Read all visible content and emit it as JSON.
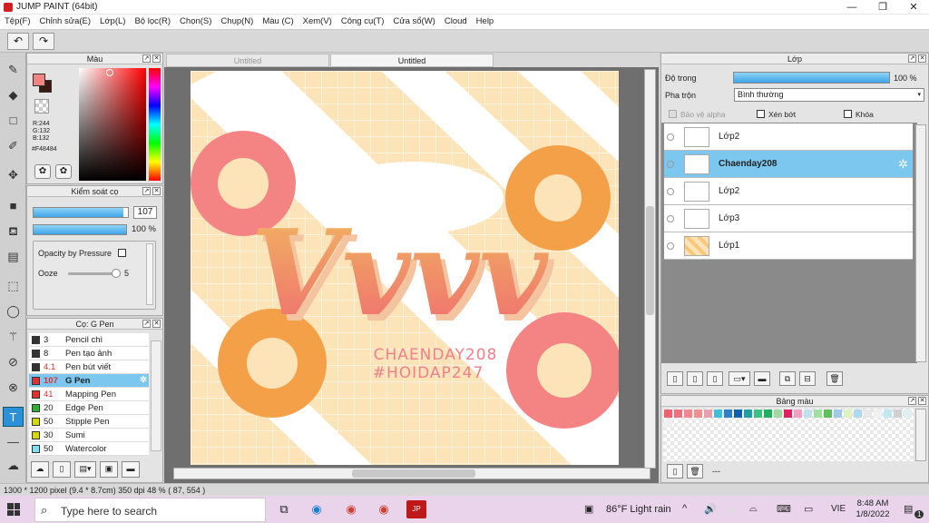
{
  "window": {
    "title": "JUMP PAINT (64bit)",
    "minimize": "—",
    "maximize": "❐",
    "close": "✕"
  },
  "menu": [
    "Tệp(F)",
    "Chỉnh sửa(E)",
    "Lớp(L)",
    "Bộ lọc(R)",
    "Chọn(S)",
    "Chụp(N)",
    "Màu (C)",
    "Xem(V)",
    "Công cụ(T)",
    "Cửa sổ(W)",
    "Cloud",
    "Help"
  ],
  "toolbar": {
    "undo": "↶",
    "redo": "↷"
  },
  "tabs": [
    "Untitled",
    "Untitled"
  ],
  "color_panel": {
    "title": "Màu",
    "r": "R:244",
    "g": "G:132",
    "b": "B:132",
    "hex": "#F48484",
    "main_color": "#f48484",
    "sub_color": "#3a1a10"
  },
  "brush_control": {
    "title": "Kiểm soát cọ",
    "size_value": "107",
    "size_fill": 0.95,
    "opacity_value": "100 %",
    "opacity_fill": 1.0,
    "opacity_by_pressure": "Opacity by Pressure",
    "ooze_label": "Ooze",
    "ooze_value": "5"
  },
  "brush_list": {
    "title": "Cọ: G Pen",
    "items": [
      {
        "size": "3",
        "name": "Pencil chì",
        "color": "#333333"
      },
      {
        "size": "8",
        "name": "Pen tạo ảnh",
        "color": "#333333"
      },
      {
        "size": "4.1",
        "name": "Pen bút viết",
        "color": "#333333"
      },
      {
        "size": "107",
        "name": "G Pen",
        "color": "#e03030"
      },
      {
        "size": "41",
        "name": "Mapping Pen",
        "color": "#e03030"
      },
      {
        "size": "20",
        "name": "Edge Pen",
        "color": "#30b030"
      },
      {
        "size": "50",
        "name": "Stipple Pen",
        "color": "#d8d800"
      },
      {
        "size": "30",
        "name": "Sumi",
        "color": "#d8d800"
      },
      {
        "size": "50",
        "name": "Watercolor",
        "color": "#80e0f0"
      }
    ]
  },
  "artwork": {
    "text_main": "Vvvv",
    "credit1": "CHAENDAY208",
    "credit2": "#HOIDAP247"
  },
  "layer_panel": {
    "title": "Lớp",
    "opacity_label": "Độ trong",
    "opacity_value": "100 %",
    "blend_label": "Pha trộn",
    "blend_value": "Bình thường",
    "protect_alpha": "Bảo vệ alpha",
    "clipping": "Xén bớt",
    "lock": "Khóa",
    "layers": [
      "Lớp2",
      "Chaenday208",
      "Lớp2",
      "Lớp3",
      "Lớp1"
    ]
  },
  "palette": {
    "title": "Bảng màu",
    "colors": [
      "#f06070",
      "#f07080",
      "#f08890",
      "#f09090",
      "#e8a0b0",
      "#40c0d8",
      "#3080c8",
      "#1060b0",
      "#20a0a0",
      "#40c080",
      "#20b060",
      "#a0d8a0",
      "#e02060",
      "#f0a0c0",
      "#c0e0f0",
      "#a0e0a0",
      "#60c060",
      "#a0c8e8",
      "#e0f0c0",
      "#b0d8f0",
      "#e8e8e8",
      "#f0f0f0",
      "#c0e8f0",
      "#d0d0d0",
      "#e0f0f0",
      "#f0f0f0"
    ],
    "dash": "---"
  },
  "status": {
    "size": "1300 * 1200 pixel",
    "dim": "(9.4 * 8.7cm)",
    "dpi": "350 dpi",
    "zoom": "48 %",
    "coords": "( 87, 554 )"
  },
  "taskbar": {
    "search_placeholder": "Type here to search",
    "weather": "86°F  Light rain",
    "lang": "VIE",
    "time": "8:48 AM",
    "date": "1/8/2022",
    "notif": "1"
  }
}
